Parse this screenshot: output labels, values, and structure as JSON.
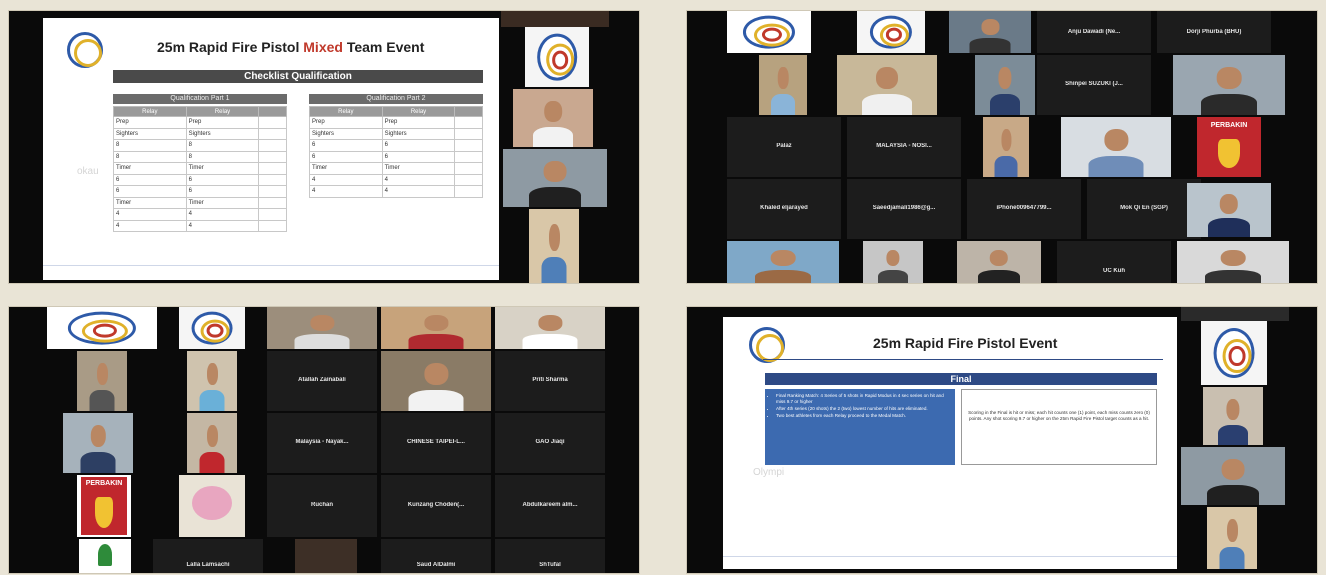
{
  "panel1": {
    "title_prefix": "25m Rapid Fire Pistol",
    "title_accent": "Mixed",
    "title_suffix": "Team Event",
    "section": "Checklist Qualification",
    "part1": "Qualification Part 1",
    "part2": "Qualification Part 2",
    "relay_header": "Relay",
    "part1_rows": [
      [
        "Prep",
        "Prep"
      ],
      [
        "Sighters",
        "Sighters"
      ],
      [
        "8",
        "8"
      ],
      [
        "8",
        "8"
      ],
      [
        "Timer",
        "Timer"
      ],
      [
        "6",
        "6"
      ],
      [
        "6",
        "6"
      ],
      [
        "Timer",
        "Timer"
      ],
      [
        "4",
        "4"
      ],
      [
        "4",
        "4"
      ]
    ],
    "part2_rows": [
      [
        "Prep",
        "Prep"
      ],
      [
        "Sighters",
        "Sighters"
      ],
      [
        "6",
        "6"
      ],
      [
        "6",
        "6"
      ],
      [
        "Timer",
        "Timer"
      ],
      [
        "4",
        "4"
      ],
      [
        "4",
        "4"
      ]
    ],
    "watermark": "okau"
  },
  "panel2": {
    "names": {
      "anju": "Anju Dawadi (Ne...",
      "dorji": "Dorji Phurba (BHU)",
      "shinpei": "Shinpei SUZUKI (J...",
      "palaz": "Palaz",
      "malaysia": "MALAYSIA - NOSI...",
      "khaled": "Khaled eljarayed",
      "saeed": "Saeedjamali1986@g...",
      "iphone": "iPhone009647799...",
      "mok": "Mok Qi En (SGP)",
      "uc_kuh": "UC Kuh"
    },
    "perbakin": "PERBAKIN"
  },
  "panel3": {
    "names": {
      "atallah": "Atallah Zainabali",
      "priti": "Priti Sharma",
      "malaysia": "Malaysia - Nayak...",
      "chinese": "CHINESE TAIPEI-L...",
      "gao": "GAO Jiaqi",
      "ruchan": "Ruchan",
      "kunzang": "Kunzang Choden(...",
      "abdul": "Abdulkareem alm...",
      "lalla": "Lalla Lamsachi",
      "saud": "Saud AlDalmi",
      "shtufal": "ShTufal"
    },
    "perbakin": "PERBAKIN"
  },
  "panel4": {
    "title": "25m Rapid Fire Pistol Event",
    "final": "Final",
    "bullets": [
      "Final Ranking Match: 4 Series of 5 shots in Rapid Modus in 4 sec series on hit and miss 9.7 or higher",
      "After 4th series (20 shots) the 2 (two) lowest number of hits are eliminated.",
      "Two best athletes from each Relay proceed to the Medal Match."
    ],
    "scoring": "Scoring in the Final is hit or miss; each hit counts one (1) point, each miss counts zero (0) points. Any shot scoring 9.7 or higher on the 25m Rapid Fire Pistol target counts as a hit.",
    "watermark": "Olympi"
  },
  "colors": {
    "background": "#e9e4d6",
    "accent_red": "#c0392b",
    "slide_blue": "#2e4a85",
    "box_blue": "#3c6ab0",
    "dark_bar": "#4a4a4a"
  }
}
